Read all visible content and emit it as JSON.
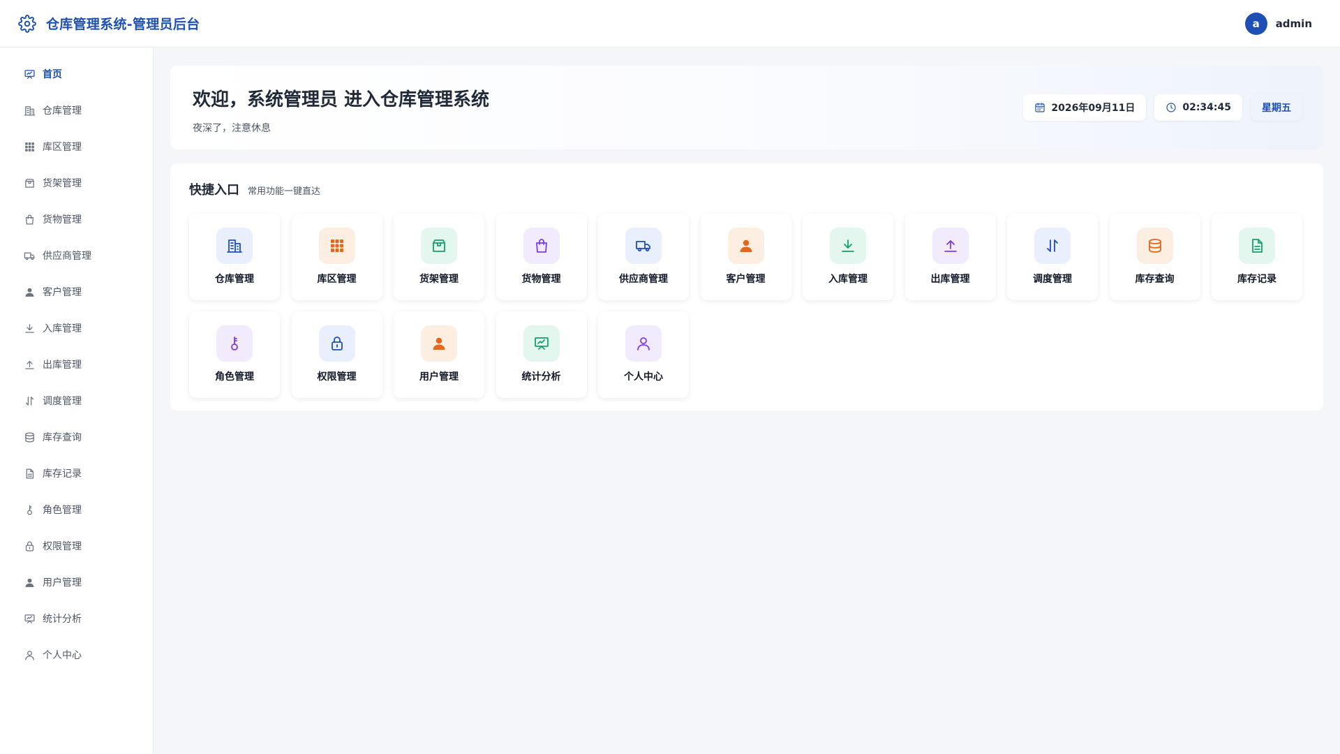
{
  "header": {
    "title": "仓库管理系统-管理员后台",
    "avatar_letter": "a",
    "username": "admin"
  },
  "sidebar": {
    "items": [
      {
        "label": "首页",
        "icon": "chart-board-icon",
        "active": true
      },
      {
        "label": "仓库管理",
        "icon": "building-icon"
      },
      {
        "label": "库区管理",
        "icon": "grid-icon"
      },
      {
        "label": "货架管理",
        "icon": "package-icon"
      },
      {
        "label": "货物管理",
        "icon": "shopping-bag-icon"
      },
      {
        "label": "供应商管理",
        "icon": "truck-icon"
      },
      {
        "label": "客户管理",
        "icon": "user-solid-icon"
      },
      {
        "label": "入库管理",
        "icon": "download-icon"
      },
      {
        "label": "出库管理",
        "icon": "upload-icon"
      },
      {
        "label": "调度管理",
        "icon": "swap-icon"
      },
      {
        "label": "库存查询",
        "icon": "database-icon"
      },
      {
        "label": "库存记录",
        "icon": "document-icon"
      },
      {
        "label": "角色管理",
        "icon": "key-icon"
      },
      {
        "label": "权限管理",
        "icon": "lock-icon"
      },
      {
        "label": "用户管理",
        "icon": "user-solid-icon"
      },
      {
        "label": "统计分析",
        "icon": "chart-board-icon"
      },
      {
        "label": "个人中心",
        "icon": "user-outline-icon"
      }
    ]
  },
  "welcome": {
    "title": "欢迎，系统管理员 进入仓库管理系统",
    "subtitle": "夜深了，注意休息",
    "date": "2026年09月11日",
    "time": "02:34:45",
    "weekday": "星期五"
  },
  "quick": {
    "title": "快捷入口",
    "subtitle": "常用功能一键直达",
    "items": [
      {
        "label": "仓库管理",
        "icon": "building-icon",
        "color": "blue"
      },
      {
        "label": "库区管理",
        "icon": "grid-icon",
        "color": "orange"
      },
      {
        "label": "货架管理",
        "icon": "package-icon",
        "color": "green"
      },
      {
        "label": "货物管理",
        "icon": "shopping-bag-icon",
        "color": "purple"
      },
      {
        "label": "供应商管理",
        "icon": "truck-icon",
        "color": "blue"
      },
      {
        "label": "客户管理",
        "icon": "user-solid-icon",
        "color": "orange"
      },
      {
        "label": "入库管理",
        "icon": "download-icon",
        "color": "green"
      },
      {
        "label": "出库管理",
        "icon": "upload-icon",
        "color": "purple"
      },
      {
        "label": "调度管理",
        "icon": "swap-icon",
        "color": "blue"
      },
      {
        "label": "库存查询",
        "icon": "database-icon",
        "color": "orange"
      },
      {
        "label": "库存记录",
        "icon": "document-icon",
        "color": "green"
      },
      {
        "label": "角色管理",
        "icon": "key-icon",
        "color": "purple"
      },
      {
        "label": "权限管理",
        "icon": "lock-icon",
        "color": "blue"
      },
      {
        "label": "用户管理",
        "icon": "user-solid-icon",
        "color": "orange"
      },
      {
        "label": "统计分析",
        "icon": "chart-board-icon",
        "color": "green"
      },
      {
        "label": "个人中心",
        "icon": "user-outline-icon",
        "color": "purple"
      }
    ]
  },
  "colors": {
    "primary": "#1e4fb5",
    "blue": "#1e4fb5",
    "orange": "#e5671c",
    "green": "#16a06b",
    "purple": "#7c3aed"
  }
}
